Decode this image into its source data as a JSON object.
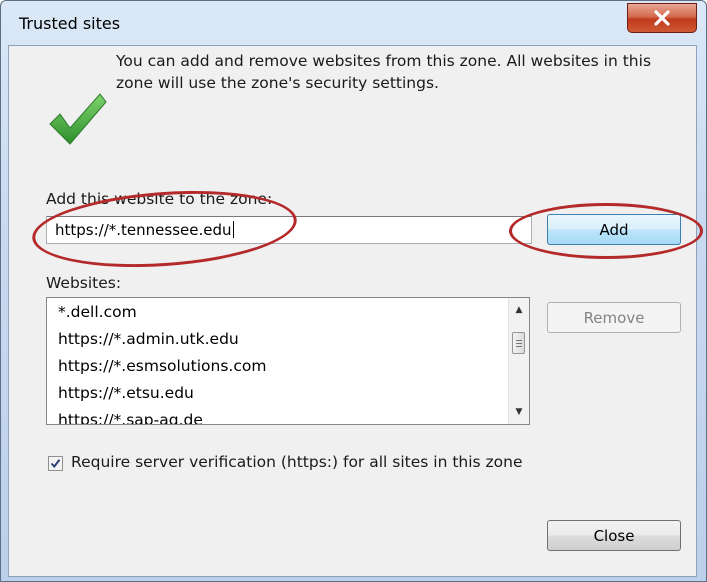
{
  "window": {
    "title": "Trusted sites",
    "close_glyph": "X"
  },
  "info": {
    "icon": "check-icon",
    "text": "You can add and remove websites from this zone. All websites in this zone will use the zone's security settings."
  },
  "add_section": {
    "label": "Add this website to the zone:",
    "input_value": "https://*.tennessee.edu",
    "add_button": "Add"
  },
  "websites": {
    "label": "Websites:",
    "items": [
      "*.dell.com",
      "https://*.admin.utk.edu",
      "https://*.esmsolutions.com",
      "https://*.etsu.edu",
      "https://*.sap-ag.de"
    ],
    "remove_button": "Remove"
  },
  "verification": {
    "checked": true,
    "label": "Require server verification (https:) for all sites in this zone"
  },
  "footer": {
    "close_button": "Close"
  },
  "colors": {
    "annotation": "#b42a2a",
    "check_green": "#3aa33a",
    "close_red": "#c0391c"
  }
}
